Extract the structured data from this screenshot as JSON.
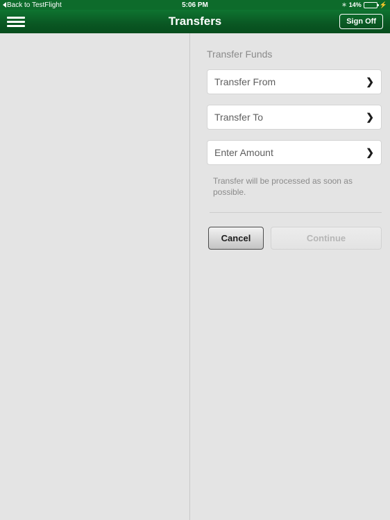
{
  "statusbar": {
    "back_label": "Back to TestFlight",
    "back_icon": "back-caret-icon",
    "time": "5:06 PM",
    "bluetooth_icon": "bluetooth-icon",
    "bluetooth_glyph": "✶",
    "battery_percent": "14%",
    "battery_level": 14,
    "charging_glyph": "⚡"
  },
  "navbar": {
    "menu_icon": "hamburger-menu-icon",
    "title": "Transfers",
    "signoff_label": "Sign Off"
  },
  "main": {
    "section_title": "Transfer Funds",
    "fields": [
      {
        "label": "Transfer From",
        "value": "",
        "chevron": "❯"
      },
      {
        "label": "Transfer To",
        "value": "",
        "chevron": "❯"
      },
      {
        "label": "Enter Amount",
        "value": "",
        "chevron": "❯"
      }
    ],
    "helper_text": "Transfer will be processed as soon as possible.",
    "buttons": {
      "cancel_label": "Cancel",
      "continue_label": "Continue",
      "continue_disabled": true
    }
  },
  "colors": {
    "brand_green_top": "#0e7430",
    "brand_green_bottom": "#064d1d",
    "page_background": "#e4e4e4",
    "field_background": "#ffffff",
    "muted_text": "#8a8a8a"
  }
}
